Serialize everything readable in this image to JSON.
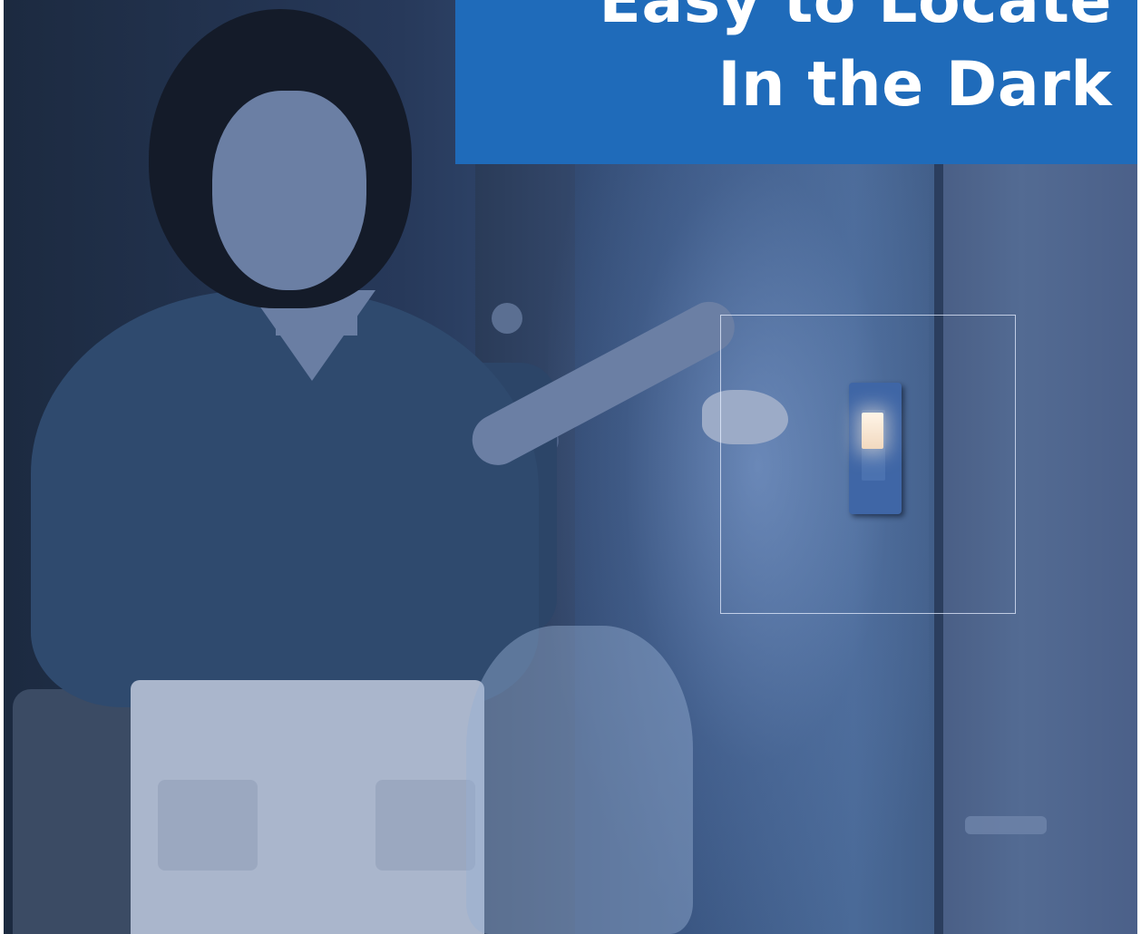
{
  "banner": {
    "background_color": "#1f6bba",
    "line1": "Easy to Locate",
    "line2": "In the Dark"
  }
}
